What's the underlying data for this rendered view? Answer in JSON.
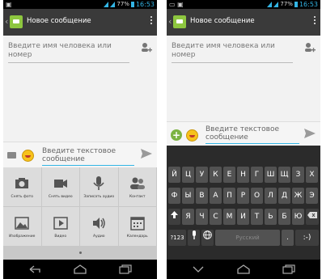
{
  "status_bar": {
    "battery_percent": "77%",
    "time": "16:53"
  },
  "action_bar": {
    "title": "Новое сообщение"
  },
  "recipient": {
    "placeholder": "Введите имя человека или номер"
  },
  "compose": {
    "placeholder": "Введите текстовое сообщение"
  },
  "attachments": [
    {
      "label": "Снять фото",
      "icon": "camera-icon"
    },
    {
      "label": "Снять видео",
      "icon": "video-camera-icon"
    },
    {
      "label": "Записать аудио",
      "icon": "microphone-icon"
    },
    {
      "label": "Контакт",
      "icon": "contact-icon"
    },
    {
      "label": "Изображение",
      "icon": "image-icon"
    },
    {
      "label": "Видео",
      "icon": "video-icon"
    },
    {
      "label": "Аудио",
      "icon": "audio-icon"
    },
    {
      "label": "Календарь",
      "icon": "calendar-icon"
    }
  ],
  "keyboard": {
    "row1": [
      "Й",
      "Ц",
      "У",
      "К",
      "Е",
      "Н",
      "Г",
      "Ш",
      "Щ",
      "З",
      "Х"
    ],
    "row2": [
      "Ф",
      "Ы",
      "В",
      "А",
      "П",
      "Р",
      "О",
      "Л",
      "Д",
      "Ж",
      "Э"
    ],
    "row3": [
      "Я",
      "Ч",
      "С",
      "М",
      "И",
      "Т",
      "Ь",
      "Б",
      "Ю"
    ],
    "symbols_key": "?123",
    "space_label": "Русский",
    "period_key": ".",
    "emoticon_key": ":-)"
  },
  "colors": {
    "accent": "#33b5e5",
    "action_bar": "#3a3a3a",
    "app_icon": "#8dc63f"
  }
}
